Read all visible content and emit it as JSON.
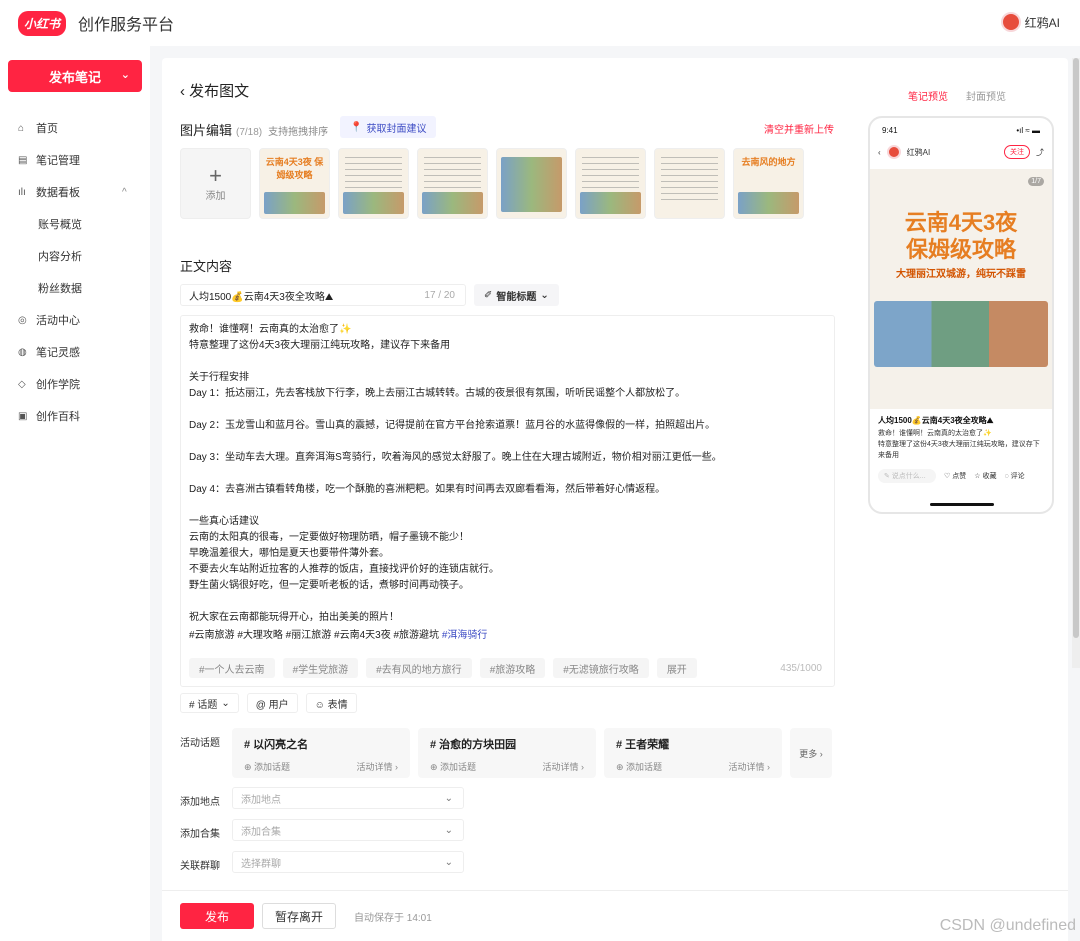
{
  "header": {
    "logo": "小红书",
    "platform": "创作服务平台",
    "user": "红鸦AI"
  },
  "sidebar": {
    "publish": "发布笔记",
    "items": [
      {
        "icon": "⌂",
        "label": "首页"
      },
      {
        "icon": "▤",
        "label": "笔记管理"
      },
      {
        "icon": "ılı",
        "label": "数据看板"
      },
      {
        "icon": "",
        "label": "账号概览"
      },
      {
        "icon": "",
        "label": "内容分析"
      },
      {
        "icon": "",
        "label": "粉丝数据"
      },
      {
        "icon": "◎",
        "label": "活动中心"
      },
      {
        "icon": "◍",
        "label": "笔记灵感"
      },
      {
        "icon": "◇",
        "label": "创作学院"
      },
      {
        "icon": "▣",
        "label": "创作百科"
      }
    ]
  },
  "page": {
    "back": "发布图文",
    "image_edit": "图片编辑",
    "image_count": "(7/18)",
    "drag_hint": "支持拖拽排序",
    "cover_suggest": "获取封面建议",
    "clear": "清空并重新上传",
    "add": "添加",
    "thumb_titles": [
      "云南4天3夜 保姆级攻略",
      "",
      "",
      "",
      "",
      "",
      "去南风的地方"
    ],
    "body_title": "正文内容",
    "title_value": "人均1500💰云南4天3夜全攻略⛰",
    "title_count": "17 / 20",
    "smart_title": "智能标题",
    "content": "救命！谁懂啊！云南真的太治愈了✨\n特意整理了这份4天3夜大理丽江纯玩攻略，建议存下来备用\n\n关于行程安排\nDay 1：抵达丽江，先去客栈放下行李，晚上去丽江古城转转。古城的夜景很有氛围，听听民谣整个人都放松了。\n\nDay 2：玉龙雪山和蓝月谷。雪山真的震撼，记得提前在官方平台抢索道票！蓝月谷的水蓝得像假的一样，拍照超出片。\n\nDay 3：坐动车去大理。直奔洱海S弯骑行，吹着海风的感觉太舒服了。晚上住在大理古城附近，物价相对丽江更低一些。\n\nDay 4：去喜洲古镇看转角楼，吃一个酥脆的喜洲粑粑。如果有时间再去双廊看看海，然后带着好心情返程。\n\n一些真心话建议\n云南的太阳真的很毒，一定要做好物理防晒，帽子墨镜不能少！\n早晚温差很大，哪怕是夏天也要带件薄外套。\n不要去火车站附近拉客的人推荐的饭店，直接找评价好的连锁店就行。\n野生菌火锅很好吃，但一定要听老板的话，煮够时间再动筷子。\n\n祝大家在云南都能玩得开心，拍出美美的照片！\n",
    "hashtags": "#云南旅游 #大理攻略 #丽江旅游 #云南4天3夜 #旅游避坑 ",
    "hashtag_blue": "#洱海骑行",
    "suggestions": [
      "#一个人去云南",
      "#学生党旅游",
      "#去有风的地方旅行",
      "#旅游攻略",
      "#无滤镜旅行攻略",
      "展开"
    ],
    "char_count": "435/1000",
    "tools": [
      "# 话题",
      "@ 用户",
      "☺ 表情"
    ],
    "activity_label": "活动话题",
    "activities": [
      {
        "title": "# 以闪亮之名",
        "add": "⊕ 添加话题",
        "detail": "活动详情 ›"
      },
      {
        "title": "# 治愈的方块田园",
        "add": "⊕ 添加话题",
        "detail": "活动详情 ›"
      },
      {
        "title": "# 王者荣耀",
        "add": "⊕ 添加话题",
        "detail": "活动详情 ›"
      }
    ],
    "more": "更多 ›",
    "location_label": "添加地点",
    "location_ph": "添加地点",
    "collection_label": "添加合集",
    "collection_ph": "添加合集",
    "group_label": "关联群聊",
    "group_ph": "选择群聊"
  },
  "footer": {
    "publish": "发布",
    "save": "暂存离开",
    "autosave": "自动保存于 14:01"
  },
  "preview": {
    "tab_note": "笔记预览",
    "tab_cover": "封面预览",
    "time": "9:41",
    "signal": "•ıl ≈ ▬",
    "account": "红鸦AI",
    "follow": "关注",
    "pager": "1/7",
    "img_title": "云南4天3夜\n保姆级攻略",
    "img_sub": "大理丽江双城游，纯玩不踩雷",
    "title": "人均1500💰云南4天3夜全攻略⛰",
    "desc": "救命！谁懂啊！云南真的太治愈了✨\n特意整理了这份4天3夜大理丽江纯玩攻略，建议存下来备用",
    "say": "✎ 说点什么...",
    "like": "♡ 点赞",
    "fav": "☆ 收藏",
    "comment": "◌ 评论"
  },
  "watermark": "CSDN @undefined"
}
